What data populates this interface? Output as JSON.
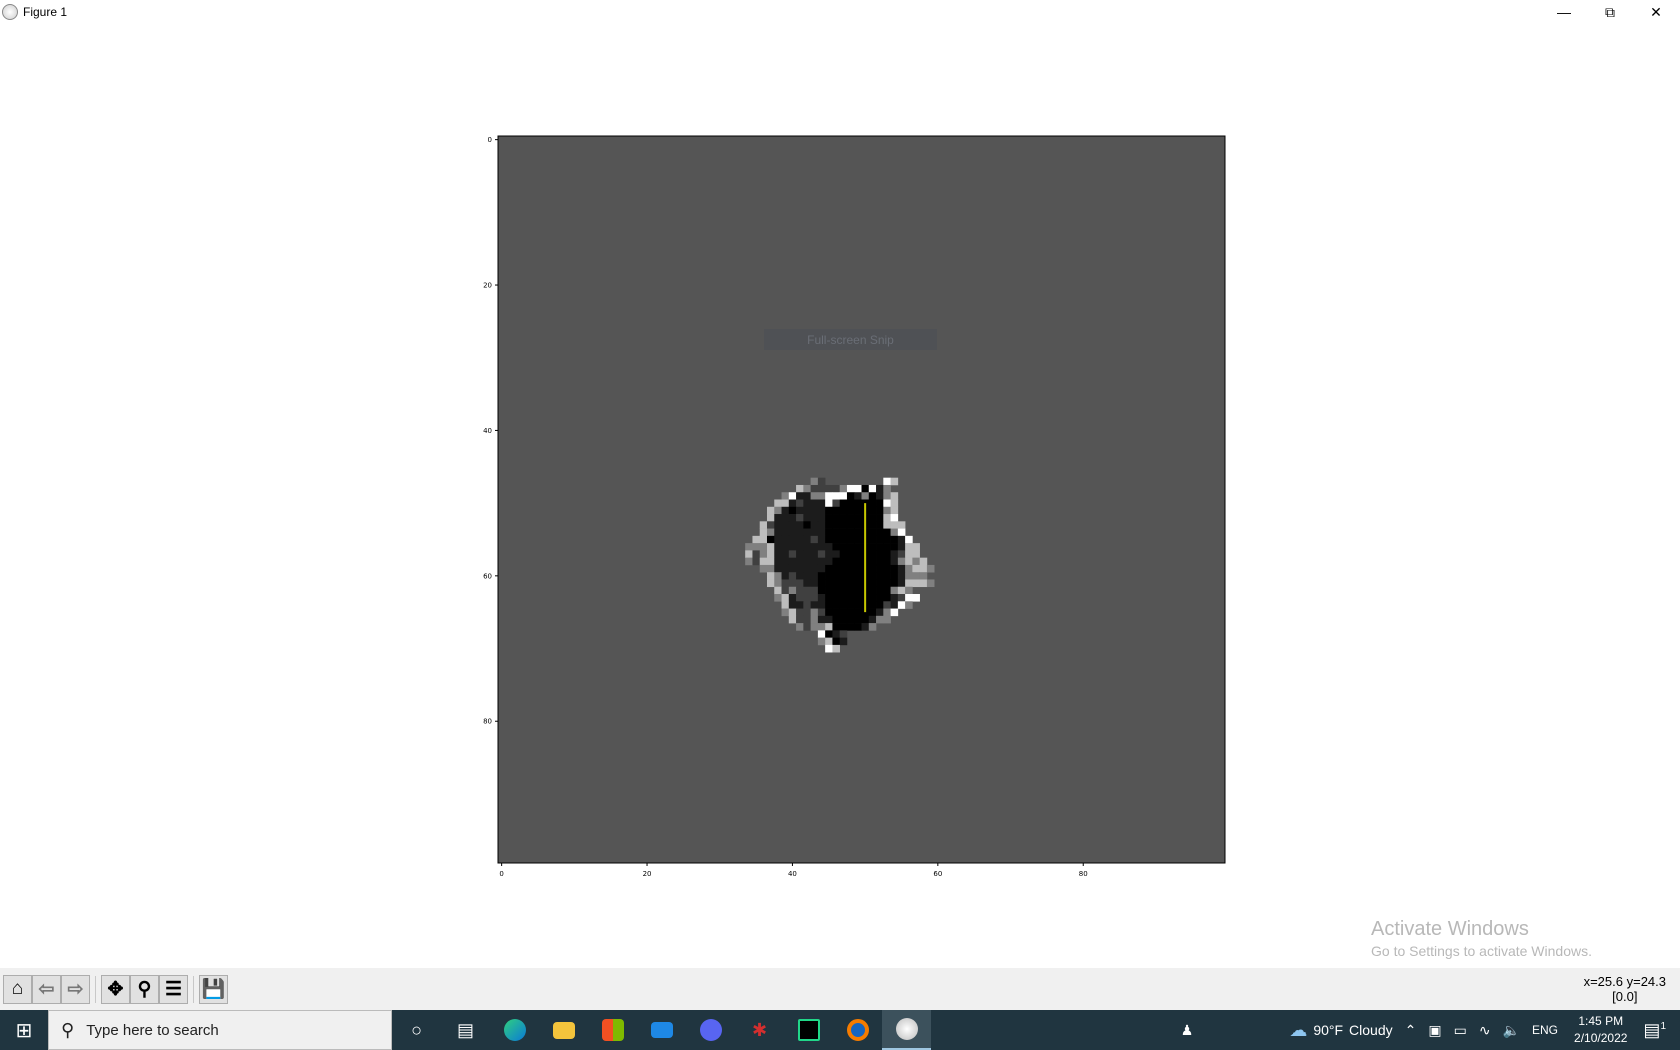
{
  "window": {
    "title": "Figure 1",
    "minimize_icon": "minimize-icon",
    "maximize_icon": "restore-icon",
    "close_icon": "close-icon"
  },
  "overlay": {
    "snip_label": "Full-screen Snip"
  },
  "watermark": {
    "line1": "Activate Windows",
    "line2": "Go to Settings to activate Windows."
  },
  "toolbar": {
    "buttons": [
      "home-icon",
      "back-icon",
      "forward-icon",
      "pan-icon",
      "zoom-icon",
      "configure-subplots-icon",
      "save-icon"
    ],
    "coords": "x=25.6 y=24.3",
    "value": "[0.0]"
  },
  "chart_data": {
    "type": "heatmap",
    "title": "",
    "xlabel": "",
    "ylabel": "",
    "image_size": [
      100,
      100
    ],
    "xlim": [
      -0.5,
      99.5
    ],
    "ylim": [
      99.5,
      -0.5
    ],
    "xticks": [
      "0",
      "20",
      "40",
      "60",
      "80"
    ],
    "yticks": [
      "0",
      "20",
      "40",
      "60",
      "80"
    ],
    "background_value": "#555555",
    "palette": {
      ".": "#555555",
      "W": "#ffffff",
      "L": "#bdbdbd",
      "M": "#808080",
      "G": "#404040",
      "D": "#1c1c1c",
      "K": "#000000"
    },
    "region_origin": {
      "col": 33,
      "row": 47
    },
    "region_rows": [
      "..........MG........WL......",
      "........LMGGGGMWWKWDM.......",
      "......MWDDMMWWWKDMKDML......",
      ".....LLDGDDDWGKKKKKKWL......",
      "....LMDKDDDDKKKKKKKKML......",
      "....LDDDGDDDKKKKKKKKLW......",
      "...LGDDDDKDDKKKKKKKKLLL.....",
      "...LMDDDDDDDKKKKKKKKKMW.....",
      "..LLKDDDDDGDKKKKKKKKKKDW....",
      ".MMMLDDDDDDDDKKKKKKKKKDLL...",
      ".LGMLDDGDDDGDDKKKKKKKDGLL...",
      ".MGLLDDDDDDDDKKKKKKKKDMLML..",
      "...MMDDDDDDDKKKKKKKKKKDMLLM.",
      "....LMDGDDDKKKKKKKKKKKDMMM..",
      "....LMGGGDDKKKKKKKKKKKDLLLM.",
      ".....LGMGGGKKKKKKKKKKMLM....",
      ".....MLDGGGDKKKKKKKKKDGWW...",
      "......LDDGDDKKKKKKKKGDWM....",
      "......MLGGMGKKKKKKKDMW......",
      ".......LGGMDDKKKKKDMM.......",
      "........MGMMLKKKKDM.........",
      "...........WKDG.............",
      "...........MLKD.............",
      "............WL.............."
    ],
    "line": {
      "x": [
        50,
        50
      ],
      "y": [
        50,
        65
      ],
      "color": "#c8c800"
    }
  },
  "taskbar": {
    "search_placeholder": "Type here to search",
    "apps": [
      "cortana-icon",
      "task-view-icon",
      "edge-icon",
      "file-explorer-icon",
      "store-icon",
      "mail-icon",
      "discord-icon",
      "bug-app-icon",
      "pycharm-icon",
      "orange-app-icon",
      "matplotlib-icon"
    ],
    "weather_temp": "90°F",
    "weather_desc": "Cloudy",
    "language": "ENG",
    "time": "1:45 PM",
    "date": "2/10/2022",
    "notification_count": "1"
  }
}
